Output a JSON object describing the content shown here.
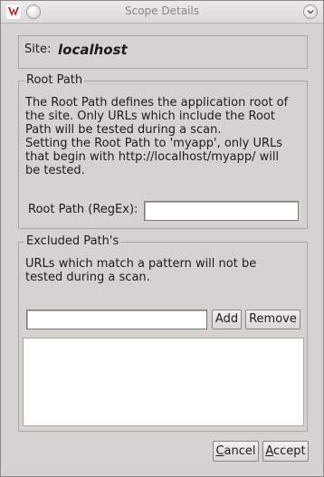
{
  "window": {
    "title": "Scope Details"
  },
  "site": {
    "label": "Site:",
    "value": "localhost"
  },
  "root_path": {
    "legend": "Root Path",
    "description_lines": [
      "The Root Path defines the application root of",
      "the site. Only URLs which include the Root",
      "Path will be tested during a scan.",
      "Setting the Root Path to 'myapp', only URLs",
      "that begin with http://localhost/myapp/ will",
      "be tested."
    ],
    "field_label": "Root Path (RegEx):",
    "field_value": ""
  },
  "excluded": {
    "legend": "Excluded Path's",
    "description_lines": [
      "URLs which match a pattern will not be",
      "tested during a scan."
    ],
    "input_value": "",
    "add_label": "Add",
    "remove_label": "Remove",
    "patterns": []
  },
  "footer": {
    "cancel_label": "Cancel",
    "accept_label": "Accept"
  }
}
